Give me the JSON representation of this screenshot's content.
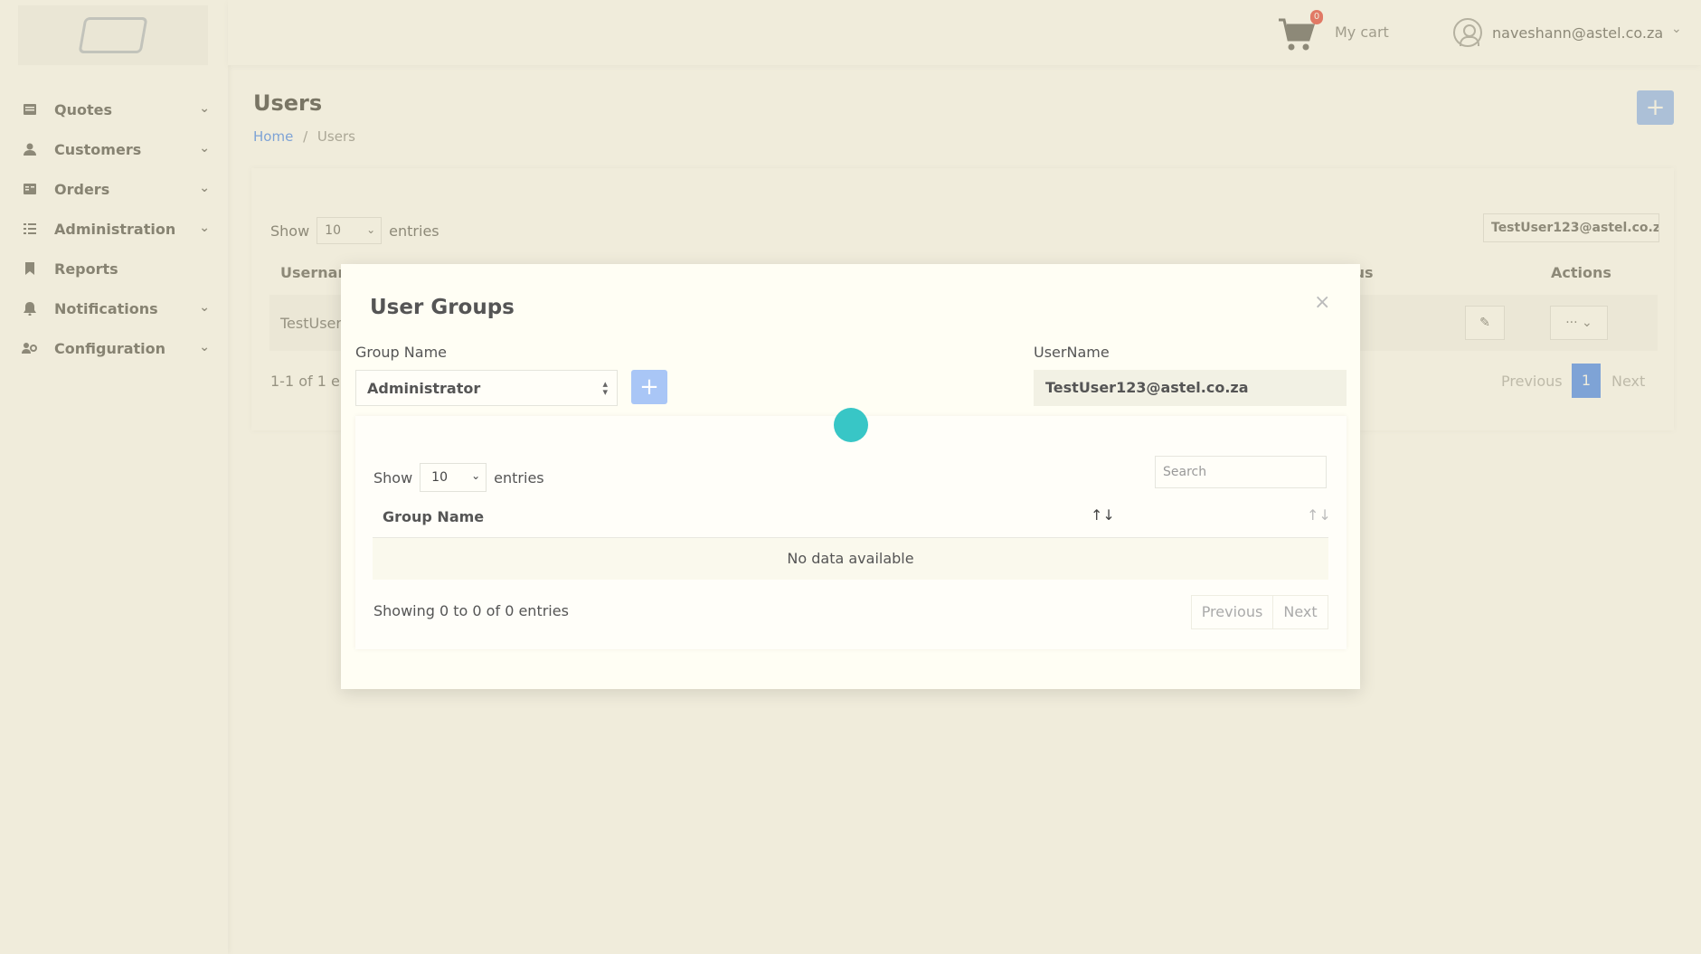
{
  "sidebar": {
    "items": [
      {
        "label": "Quotes",
        "icon": "quotes-icon",
        "has_chevron": true
      },
      {
        "label": "Customers",
        "icon": "user-icon",
        "has_chevron": true
      },
      {
        "label": "Orders",
        "icon": "orders-icon",
        "has_chevron": true
      },
      {
        "label": "Administration",
        "icon": "list-icon",
        "has_chevron": true
      },
      {
        "label": "Reports",
        "icon": "bookmark-icon",
        "has_chevron": false
      },
      {
        "label": "Notifications",
        "icon": "bell-icon",
        "has_chevron": true
      },
      {
        "label": "Configuration",
        "icon": "users-cog-icon",
        "has_chevron": true
      }
    ]
  },
  "header": {
    "cart_count": "0",
    "cart_label": "My cart",
    "user_email": "naveshann@astel.co.za"
  },
  "page": {
    "title": "Users",
    "breadcrumb": {
      "home": "Home",
      "separator": "/",
      "current": "Users"
    },
    "add_symbol": "+"
  },
  "users_table": {
    "show_label": "Show",
    "entries_value": "10",
    "entries_label": "entries",
    "search_value": "TestUser123@astel.co.z",
    "columns": {
      "username": "Usernam",
      "status": "tus",
      "actions": "Actions"
    },
    "rows": [
      {
        "username": "TestUser",
        "status": "e"
      }
    ],
    "info": "1-1 of 1 en",
    "pagination": {
      "previous": "Previous",
      "page": "1",
      "next": "Next"
    }
  },
  "modal": {
    "title": "User Groups",
    "close": "×",
    "group_name_label": "Group Name",
    "group_name_value": "Administrator",
    "add_symbol": "+",
    "username_label": "UserName",
    "username_value": "TestUser123@astel.co.za",
    "table": {
      "show_label": "Show",
      "entries_value": "10",
      "entries_label": "entries",
      "search_placeholder": "Search",
      "column_group_name": "Group Name",
      "no_data": "No data available",
      "info": "Showing 0 to 0 of 0 entries",
      "previous": "Previous",
      "next": "Next"
    }
  },
  "colors": {
    "accent": "#3b82f6",
    "spinner": "#38c6c6",
    "badge": "#e53935"
  }
}
